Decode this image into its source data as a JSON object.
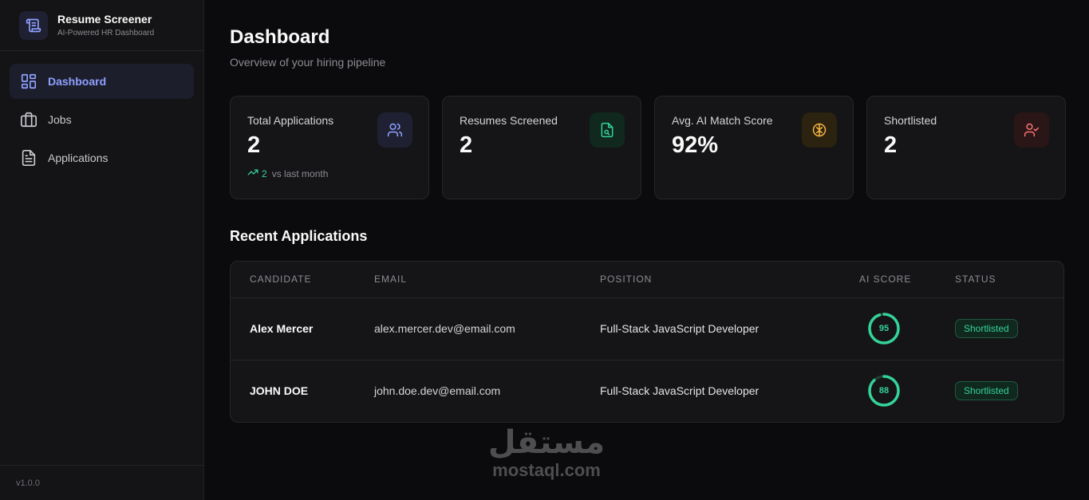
{
  "brand": {
    "title": "Resume Screener",
    "subtitle": "AI-Powered HR Dashboard"
  },
  "nav": [
    {
      "label": "Dashboard",
      "icon": "layout-grid-icon",
      "active": true
    },
    {
      "label": "Jobs",
      "icon": "briefcase-icon",
      "active": false
    },
    {
      "label": "Applications",
      "icon": "file-text-icon",
      "active": false
    }
  ],
  "version": "v1.0.0",
  "page": {
    "title": "Dashboard",
    "subtitle": "Overview of your hiring pipeline"
  },
  "stats": [
    {
      "label": "Total Applications",
      "value": "2",
      "trend_value": "2",
      "trend_text": "vs last month",
      "icon": "users-icon",
      "color": "#8fa1ff"
    },
    {
      "label": "Resumes Screened",
      "value": "2",
      "icon": "file-search-icon",
      "color": "#34d399"
    },
    {
      "label": "Avg. AI Match Score",
      "value": "92%",
      "icon": "brain-icon",
      "color": "#f5b342"
    },
    {
      "label": "Shortlisted",
      "value": "2",
      "icon": "user-check-icon",
      "color": "#f87171"
    }
  ],
  "recent": {
    "title": "Recent Applications",
    "columns": [
      "Candidate",
      "Email",
      "Position",
      "AI Score",
      "Status"
    ],
    "rows": [
      {
        "candidate": "Alex Mercer",
        "email": "alex.mercer.dev@email.com",
        "position": "Full-Stack JavaScript Developer",
        "score": 95,
        "status": "Shortlisted"
      },
      {
        "candidate": "JOHN DOE",
        "email": "john.doe.dev@email.com",
        "position": "Full-Stack JavaScript Developer",
        "score": 88,
        "status": "Shortlisted"
      }
    ]
  },
  "watermark": {
    "arabic": "مستقل",
    "latin": "mostaql.com"
  },
  "colors": {
    "accent": "#8fa1ff",
    "success": "#34d399",
    "warning": "#f5b342",
    "danger": "#f87171"
  }
}
